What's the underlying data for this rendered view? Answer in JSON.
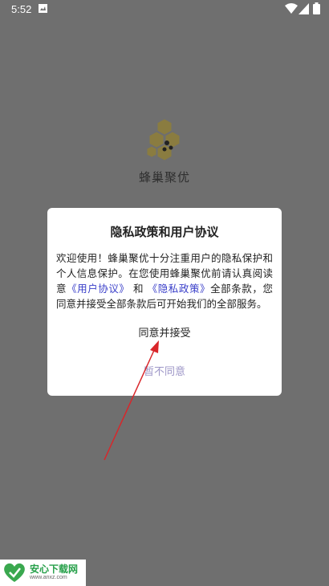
{
  "status_bar": {
    "time": "5:52",
    "icons": [
      "notification-icon",
      "wifi-icon",
      "signal-icon",
      "battery-icon"
    ]
  },
  "app": {
    "name": "蜂巢聚优",
    "logo_icon": "honeycomb-logo-icon",
    "logo_color": "#9a8a4a"
  },
  "dialog": {
    "title": "隐私政策和用户协议",
    "body_part1": "欢迎使用！蜂巢聚优十分注重用户的隐私保护和个人信息保护。在您使用蜂巢聚优前请认真阅读意",
    "link_user_agreement": "《用户协议》",
    "body_and": "和",
    "link_privacy_policy": "《隐私政策》",
    "body_part2": "全部条款，您同意并接受全部条款后可开始我们的全部服务。",
    "agree_label": "同意并接受",
    "disagree_label": "暂不同意",
    "link_color": "#3a3fc9",
    "disagree_color": "#9d96c7"
  },
  "annotation": {
    "type": "red-arrow",
    "color": "#d9262a"
  },
  "watermark": {
    "title": "安心下载网",
    "url": "www.anxz.com"
  }
}
